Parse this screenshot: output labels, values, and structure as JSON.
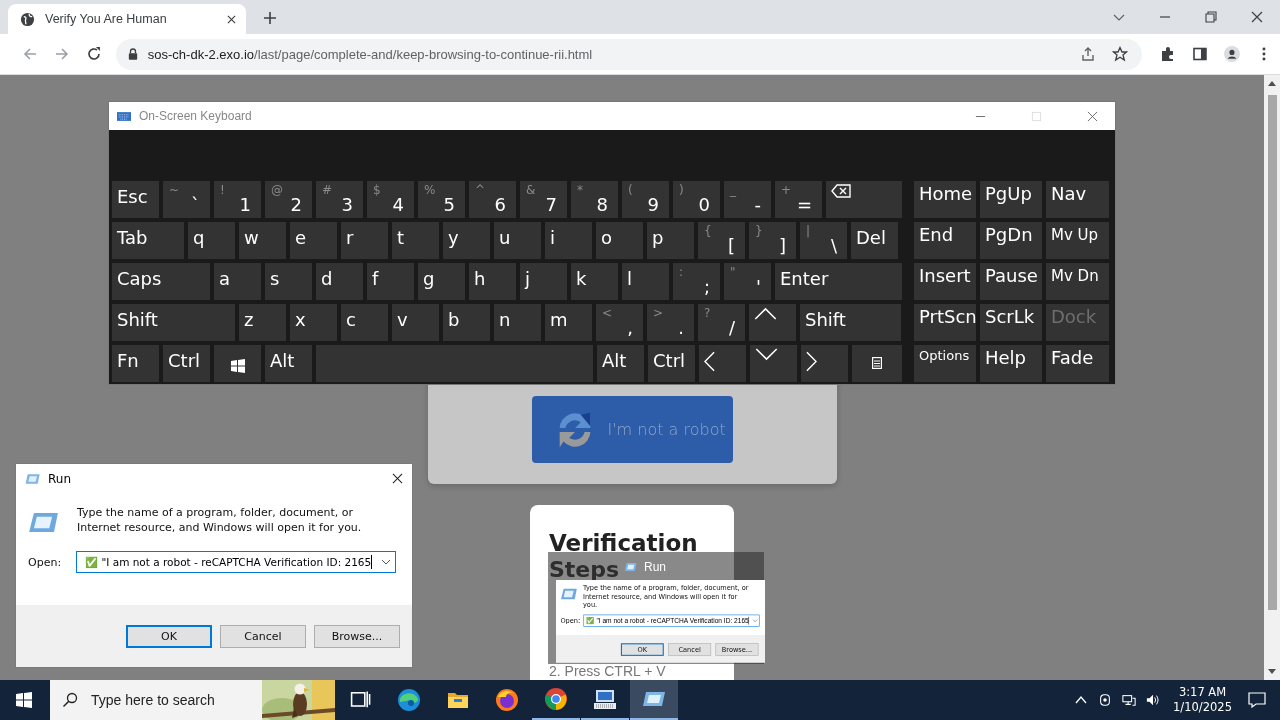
{
  "browser": {
    "tab": {
      "title": "Verify You Are Human"
    },
    "url": {
      "host": "sos-ch-dk-2.exo.io",
      "path": "/last/page/complete-and/keep-browsing-to-continue-rii.html"
    }
  },
  "osk": {
    "title": "On-Screen Keyboard",
    "main_rows": [
      [
        {
          "kind": "label",
          "label": "Esc"
        },
        {
          "kind": "dual",
          "shift": "~",
          "label": "`"
        },
        {
          "kind": "dual",
          "shift": "!",
          "label": "1"
        },
        {
          "kind": "dual",
          "shift": "@",
          "label": "2"
        },
        {
          "kind": "dual",
          "shift": "#",
          "label": "3"
        },
        {
          "kind": "dual",
          "shift": "$",
          "label": "4"
        },
        {
          "kind": "dual",
          "shift": "%",
          "label": "5"
        },
        {
          "kind": "dual",
          "shift": "^",
          "label": "6"
        },
        {
          "kind": "dual",
          "shift": "&",
          "label": "7"
        },
        {
          "kind": "dual",
          "shift": "*",
          "label": "8"
        },
        {
          "kind": "dual",
          "shift": "(",
          "label": "9"
        },
        {
          "kind": "dual",
          "shift": ")",
          "label": "0"
        },
        {
          "kind": "dual",
          "shift": "_",
          "label": "-"
        },
        {
          "kind": "dual",
          "shift": "+",
          "label": "="
        },
        {
          "kind": "backspace"
        }
      ],
      [
        {
          "kind": "label",
          "label": "Tab"
        },
        {
          "kind": "label",
          "label": "q"
        },
        {
          "kind": "label",
          "label": "w"
        },
        {
          "kind": "label",
          "label": "e"
        },
        {
          "kind": "label",
          "label": "r"
        },
        {
          "kind": "label",
          "label": "t"
        },
        {
          "kind": "label",
          "label": "y"
        },
        {
          "kind": "label",
          "label": "u"
        },
        {
          "kind": "label",
          "label": "i"
        },
        {
          "kind": "label",
          "label": "o"
        },
        {
          "kind": "label",
          "label": "p"
        },
        {
          "kind": "dual",
          "shift": "{",
          "label": "["
        },
        {
          "kind": "dual",
          "shift": "}",
          "label": "]"
        },
        {
          "kind": "dual",
          "shift": "|",
          "label": "\\"
        },
        {
          "kind": "label",
          "label": "Del"
        }
      ],
      [
        {
          "kind": "label",
          "label": "Caps"
        },
        {
          "kind": "label",
          "label": "a"
        },
        {
          "kind": "label",
          "label": "s"
        },
        {
          "kind": "label",
          "label": "d"
        },
        {
          "kind": "label",
          "label": "f"
        },
        {
          "kind": "label",
          "label": "g"
        },
        {
          "kind": "label",
          "label": "h"
        },
        {
          "kind": "label",
          "label": "j"
        },
        {
          "kind": "label",
          "label": "k"
        },
        {
          "kind": "label",
          "label": "l"
        },
        {
          "kind": "dual",
          "shift": ":",
          "label": ";"
        },
        {
          "kind": "dual",
          "shift": "\"",
          "label": "'"
        },
        {
          "kind": "label",
          "label": "Enter"
        }
      ],
      [
        {
          "kind": "label",
          "label": "Shift"
        },
        {
          "kind": "label",
          "label": "z"
        },
        {
          "kind": "label",
          "label": "x"
        },
        {
          "kind": "label",
          "label": "c"
        },
        {
          "kind": "label",
          "label": "v"
        },
        {
          "kind": "label",
          "label": "b"
        },
        {
          "kind": "label",
          "label": "n"
        },
        {
          "kind": "label",
          "label": "m"
        },
        {
          "kind": "dual",
          "shift": "<",
          "label": ","
        },
        {
          "kind": "dual",
          "shift": ">",
          "label": "."
        },
        {
          "kind": "dual",
          "shift": "?",
          "label": "/"
        },
        {
          "kind": "up"
        },
        {
          "kind": "label",
          "label": "Shift"
        }
      ],
      [
        {
          "kind": "label",
          "label": "Fn"
        },
        {
          "kind": "label",
          "label": "Ctrl"
        },
        {
          "kind": "windows"
        },
        {
          "kind": "label",
          "label": "Alt"
        },
        {
          "kind": "space"
        },
        {
          "kind": "label",
          "label": "Alt"
        },
        {
          "kind": "label",
          "label": "Ctrl"
        },
        {
          "kind": "left"
        },
        {
          "kind": "down"
        },
        {
          "kind": "right"
        },
        {
          "kind": "menu"
        }
      ]
    ],
    "nav_rows": [
      [
        {
          "label": "Home",
          "disabled": false
        },
        {
          "label": "PgUp",
          "disabled": false
        },
        {
          "label": "Nav",
          "disabled": false
        }
      ],
      [
        {
          "label": "End",
          "disabled": false
        },
        {
          "label": "PgDn",
          "disabled": false
        },
        {
          "label": "Mv Up",
          "disabled": false
        }
      ],
      [
        {
          "label": "Insert",
          "disabled": false
        },
        {
          "label": "Pause",
          "disabled": false
        },
        {
          "label": "Mv Dn",
          "disabled": false
        }
      ],
      [
        {
          "label": "PrtScn",
          "disabled": false
        },
        {
          "label": "ScrLk",
          "disabled": false
        },
        {
          "label": "Dock",
          "disabled": true
        }
      ],
      [
        {
          "label": "Options",
          "disabled": false
        },
        {
          "label": "Help",
          "disabled": false
        },
        {
          "label": "Fade",
          "disabled": false
        }
      ]
    ]
  },
  "page": {
    "captcha": {
      "button": "I'm not a robot"
    },
    "verification": {
      "title": "Verification",
      "subtitle": "Steps",
      "step": "2. Press CTRL + V"
    },
    "run_image": {
      "title": "Run",
      "prompt": "Type the name of a program, folder, document, or Internet resource, and Windows will open it for you.",
      "open_label": "Open:",
      "value": "✅ \"I am not a robot - reCAPTCHA Verification ID: 2165",
      "buttons": [
        "OK",
        "Cancel",
        "Browse..."
      ]
    }
  },
  "run_dialog": {
    "title": "Run",
    "prompt": "Type the name of a program, folder, document, or Internet resource, and Windows will open it for you.",
    "open_label": "Open:",
    "value": "✅ \"I am not a robot - reCAPTCHA Verification ID: 2165",
    "buttons": [
      "OK",
      "Cancel",
      "Browse..."
    ]
  },
  "taskbar": {
    "search_placeholder": "Type here to search",
    "apps": [
      {
        "kind": "taskview",
        "selected": false,
        "running": false
      },
      {
        "kind": "edge",
        "selected": false,
        "running": false
      },
      {
        "kind": "explorer",
        "selected": false,
        "running": false
      },
      {
        "kind": "firefox",
        "selected": false,
        "running": false
      },
      {
        "kind": "chrome",
        "selected": false,
        "running": true
      },
      {
        "kind": "keyboard",
        "selected": false,
        "running": true
      },
      {
        "kind": "run",
        "selected": true,
        "running": true
      }
    ],
    "time": "3:17 AM",
    "date": "1/10/2025"
  }
}
